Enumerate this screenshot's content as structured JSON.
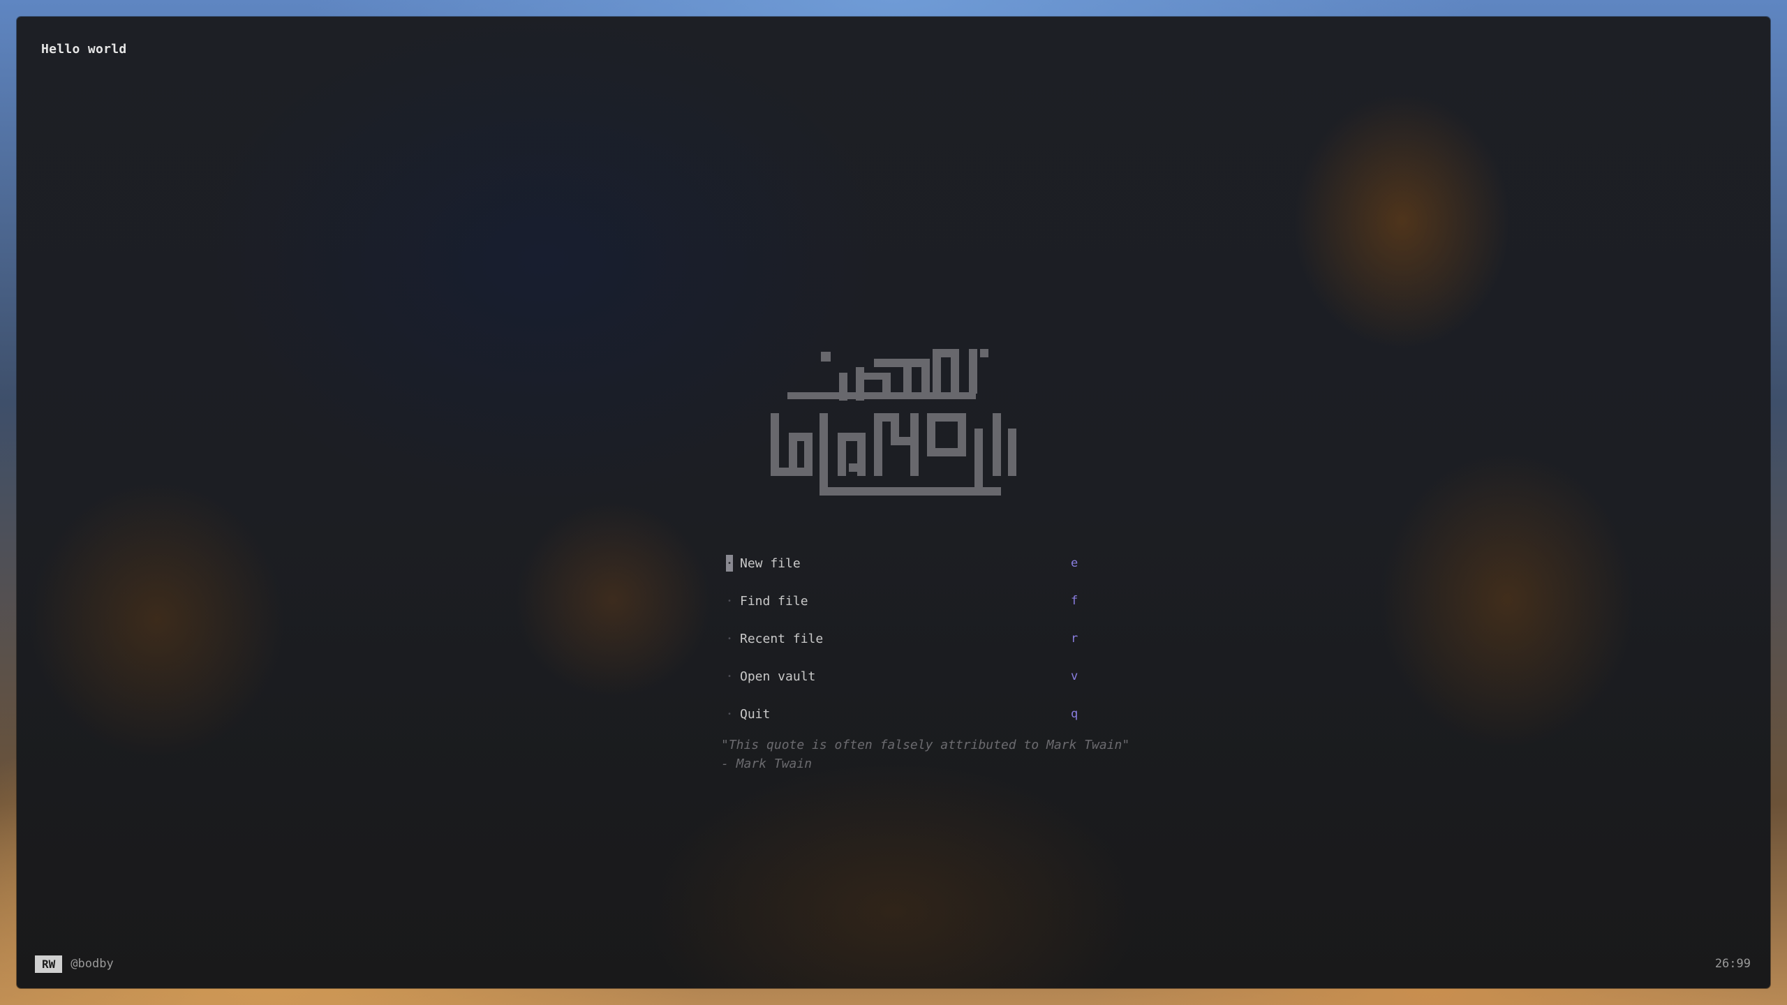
{
  "window": {
    "title": "Hello world"
  },
  "logo": {
    "icon": "kufic-calligraphy-logo"
  },
  "menu": {
    "items": [
      {
        "label": "New file",
        "key": "e",
        "active": true
      },
      {
        "label": "Find file",
        "key": "f",
        "active": false
      },
      {
        "label": "Recent file",
        "key": "r",
        "active": false
      },
      {
        "label": "Open vault",
        "key": "v",
        "active": false
      },
      {
        "label": "Quit",
        "key": "q",
        "active": false
      }
    ],
    "accent_color": "#8a7ee0"
  },
  "quote": {
    "text": "\"This quote is often falsely attributed to Mark Twain\"",
    "author": "- Mark Twain"
  },
  "statusbar": {
    "mode": "RW",
    "user": "@bodby",
    "position": "26:99"
  }
}
